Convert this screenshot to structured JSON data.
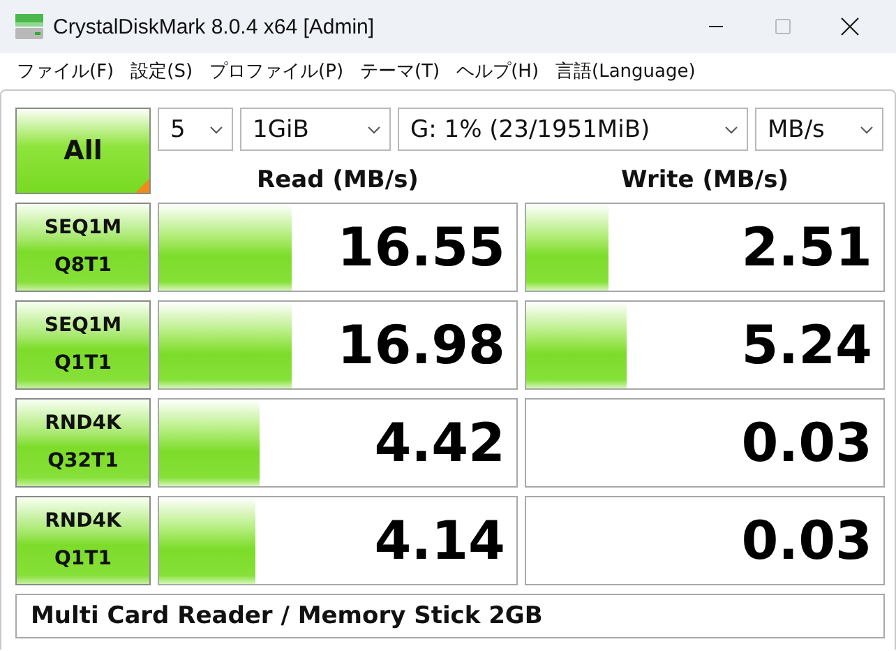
{
  "window": {
    "title": "CrystalDiskMark 8.0.4 x64 [Admin]"
  },
  "menu": [
    "ファイル(F)",
    "設定(S)",
    "プロファイル(P)",
    "テーマ(T)",
    "ヘルプ(H)",
    "言語(Language)"
  ],
  "all_button": "All",
  "selectors": [
    {
      "value": "5"
    },
    {
      "value": "1GiB"
    },
    {
      "value": "G: 1% (23/1951MiB)"
    },
    {
      "value": "MB/s"
    }
  ],
  "columns": [
    "Read (MB/s)",
    "Write (MB/s)"
  ],
  "tests": [
    {
      "label": [
        "SEQ1M",
        "Q8T1"
      ],
      "read": {
        "value": "16.55",
        "level": 0.37
      },
      "write": {
        "value": "2.51",
        "level": 0.23
      }
    },
    {
      "label": [
        "SEQ1M",
        "Q1T1"
      ],
      "read": {
        "value": "16.98",
        "level": 0.37
      },
      "write": {
        "value": "5.24",
        "level": 0.28
      }
    },
    {
      "label": [
        "RND4K",
        "Q32T1"
      ],
      "read": {
        "value": "4.42",
        "level": 0.28
      },
      "write": {
        "value": "0.03"
      }
    },
    {
      "label": [
        "RND4K",
        "Q1T1"
      ],
      "read": {
        "value": "4.14",
        "level": 0.27
      },
      "write": {
        "value": "0.03"
      }
    }
  ],
  "drive_info": "Multi Card Reader / Memory Stick 2GB"
}
